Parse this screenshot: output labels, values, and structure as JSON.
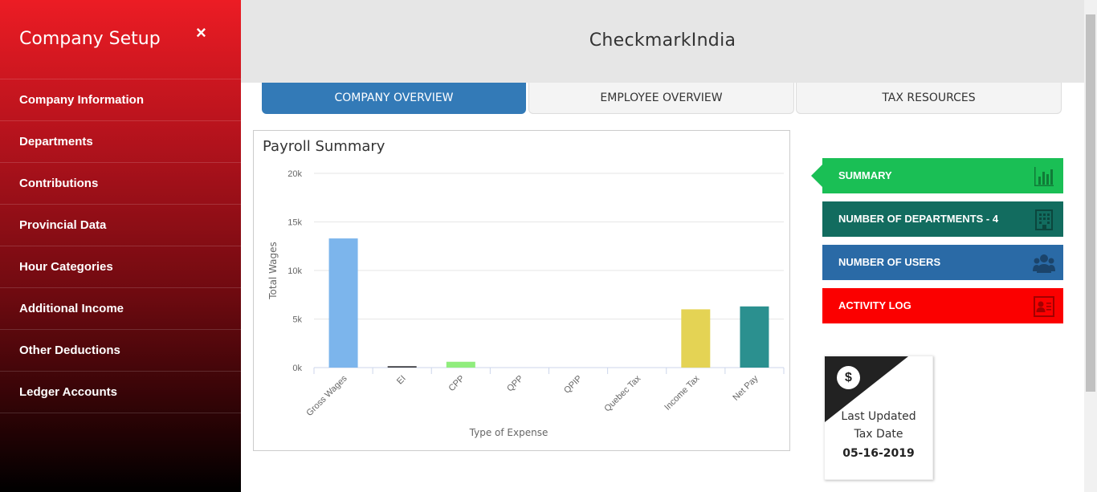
{
  "sidebar": {
    "title": "Company Setup",
    "close_icon": "×",
    "items": [
      {
        "label": "Company Information"
      },
      {
        "label": "Departments"
      },
      {
        "label": "Contributions"
      },
      {
        "label": "Provincial Data"
      },
      {
        "label": "Hour Categories"
      },
      {
        "label": "Additional Income"
      },
      {
        "label": "Other Deductions"
      },
      {
        "label": "Ledger Accounts"
      }
    ]
  },
  "header": {
    "brand": "CheckmarkIndia"
  },
  "tabs": [
    {
      "label": "COMPANY OVERVIEW",
      "active": true
    },
    {
      "label": "EMPLOYEE OVERVIEW",
      "active": false
    },
    {
      "label": "TAX RESOURCES",
      "active": false
    }
  ],
  "panel": {
    "title": "Payroll Summary"
  },
  "chart_data": {
    "type": "bar",
    "title": "Payroll Summary",
    "xlabel": "Type of Expense",
    "ylabel": "Total Wages",
    "ylim": [
      0,
      20000
    ],
    "yticks": [
      "0k",
      "5k",
      "10k",
      "15k",
      "20k"
    ],
    "ytick_values": [
      0,
      5000,
      10000,
      15000,
      20000
    ],
    "grid": true,
    "categories": [
      "Gross Wages",
      "EI",
      "CPP",
      "QPP",
      "QPIP",
      "Quebec Tax",
      "Income Tax",
      "Net Pay"
    ],
    "values": [
      13300,
      150,
      600,
      0,
      0,
      0,
      6000,
      6300
    ],
    "colors": [
      "#7cb5ec",
      "#434348",
      "#90ed7d",
      "#f7a35c",
      "#8085e9",
      "#f15c80",
      "#e4d354",
      "#2b908f"
    ]
  },
  "actions": [
    {
      "label": "SUMMARY",
      "icon": "bar-chart-icon",
      "color": "#1abf55"
    },
    {
      "label": "NUMBER OF DEPARTMENTS - 4",
      "icon": "building-icon",
      "color": "#126c5f"
    },
    {
      "label": "NUMBER OF USERS",
      "icon": "users-icon",
      "color": "#2a6aa6"
    },
    {
      "label": "ACTIVITY LOG",
      "icon": "id-card-icon",
      "color": "#fb0000"
    }
  ],
  "tax_card": {
    "icon": "$",
    "label_line1": "Last Updated",
    "label_line2": "Tax Date",
    "date": "05-16-2019"
  }
}
